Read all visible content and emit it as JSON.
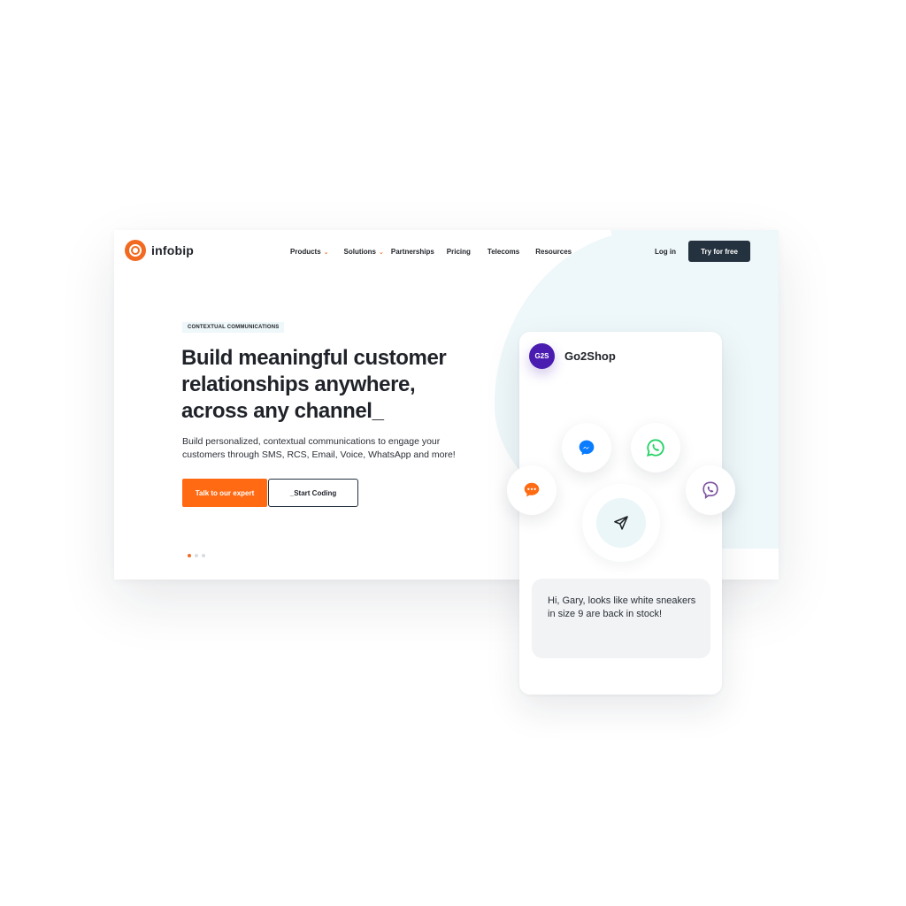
{
  "brand": {
    "name": "infobip"
  },
  "nav": {
    "items": [
      {
        "label": "Products",
        "has_dropdown": true
      },
      {
        "label": "Solutions",
        "has_dropdown": true
      },
      {
        "label": "Partnerships",
        "has_dropdown": false
      },
      {
        "label": "Pricing",
        "has_dropdown": false
      },
      {
        "label": "Telecoms",
        "has_dropdown": false
      },
      {
        "label": "Resources",
        "has_dropdown": false
      }
    ],
    "login_label": "Log in",
    "cta_label": "Try for free"
  },
  "hero": {
    "tag": "CONTEXTUAL COMMUNICATIONS",
    "headline": "Build meaningful customer relationships anywhere, across any channel_",
    "subtitle": "Build personalized, contextual communications to engage your customers through SMS, RCS, Email, Voice, WhatsApp and more!",
    "primary_button": "Talk to our expert",
    "secondary_button": "_Start Coding",
    "carousel": {
      "total": 3,
      "active_index": 0
    }
  },
  "phone": {
    "avatar_initials": "G2S",
    "shop_name": "Go2Shop",
    "channel_icons": [
      "messenger-icon",
      "whatsapp-icon",
      "chat-icon",
      "viber-icon",
      "send-icon"
    ],
    "message": "Hi, Gary, looks like white sneakers in size 9 are back in stock!"
  },
  "colors": {
    "accent": "#ff6a13",
    "dark": "#24313e",
    "avatar": "#4a1bb0",
    "messenger": "#0a7cff",
    "whatsapp": "#25d366",
    "viber": "#7b519d",
    "blob": "#eef7f9"
  }
}
